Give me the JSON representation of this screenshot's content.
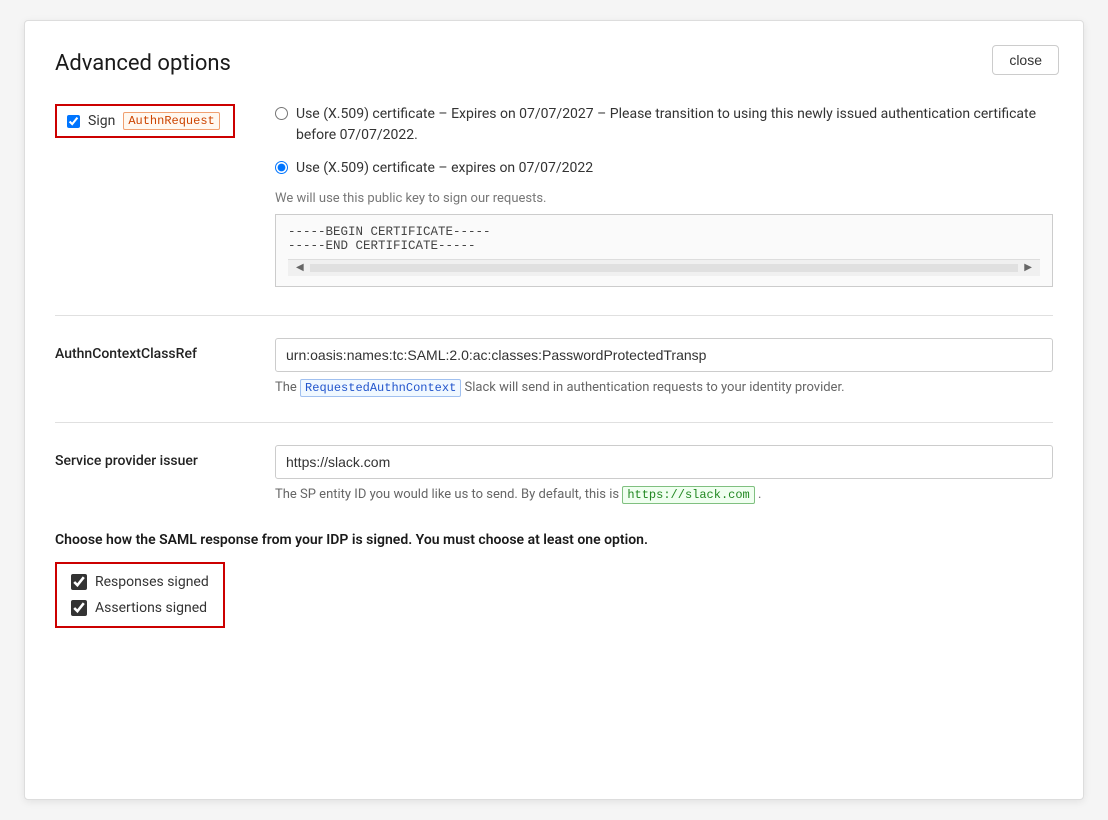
{
  "dialog": {
    "title": "Advanced options",
    "close_button": "close"
  },
  "sign_authn": {
    "checkbox_checked": true,
    "label": "Sign",
    "tag": "AuthnRequest",
    "cert_option1": {
      "label": "Use (X.509) certificate – Expires on 07/07/2027 – Please transition to using this newly issued authentication certificate before 07/07/2022.",
      "selected": false
    },
    "cert_option2": {
      "label": "Use (X.509) certificate – expires on 07/07/2022",
      "selected": true
    },
    "public_key_hint": "We will use this public key to sign our requests.",
    "cert_begin": "-----BEGIN CERTIFICATE-----",
    "cert_end": "-----END CERTIFICATE-----"
  },
  "authn_context": {
    "label": "AuthnContextClassRef",
    "value": "urn:oasis:names:tc:SAML:2.0:ac:classes:PasswordProtectedTransp",
    "hint_prefix": "The",
    "hint_tag": "RequestedAuthnContext",
    "hint_suffix": "Slack will send in authentication requests to your identity provider."
  },
  "service_provider": {
    "label": "Service provider issuer",
    "value": "https://slack.com",
    "hint_prefix": "The SP entity ID you would like us to send. By default, this is",
    "hint_tag": "https://slack.com",
    "hint_suffix": "."
  },
  "signing_section": {
    "title": "Choose how the SAML response from your IDP is signed. You must choose at least one option.",
    "responses_signed": {
      "label": "Responses signed",
      "checked": true
    },
    "assertions_signed": {
      "label": "Assertions signed",
      "checked": true
    }
  }
}
